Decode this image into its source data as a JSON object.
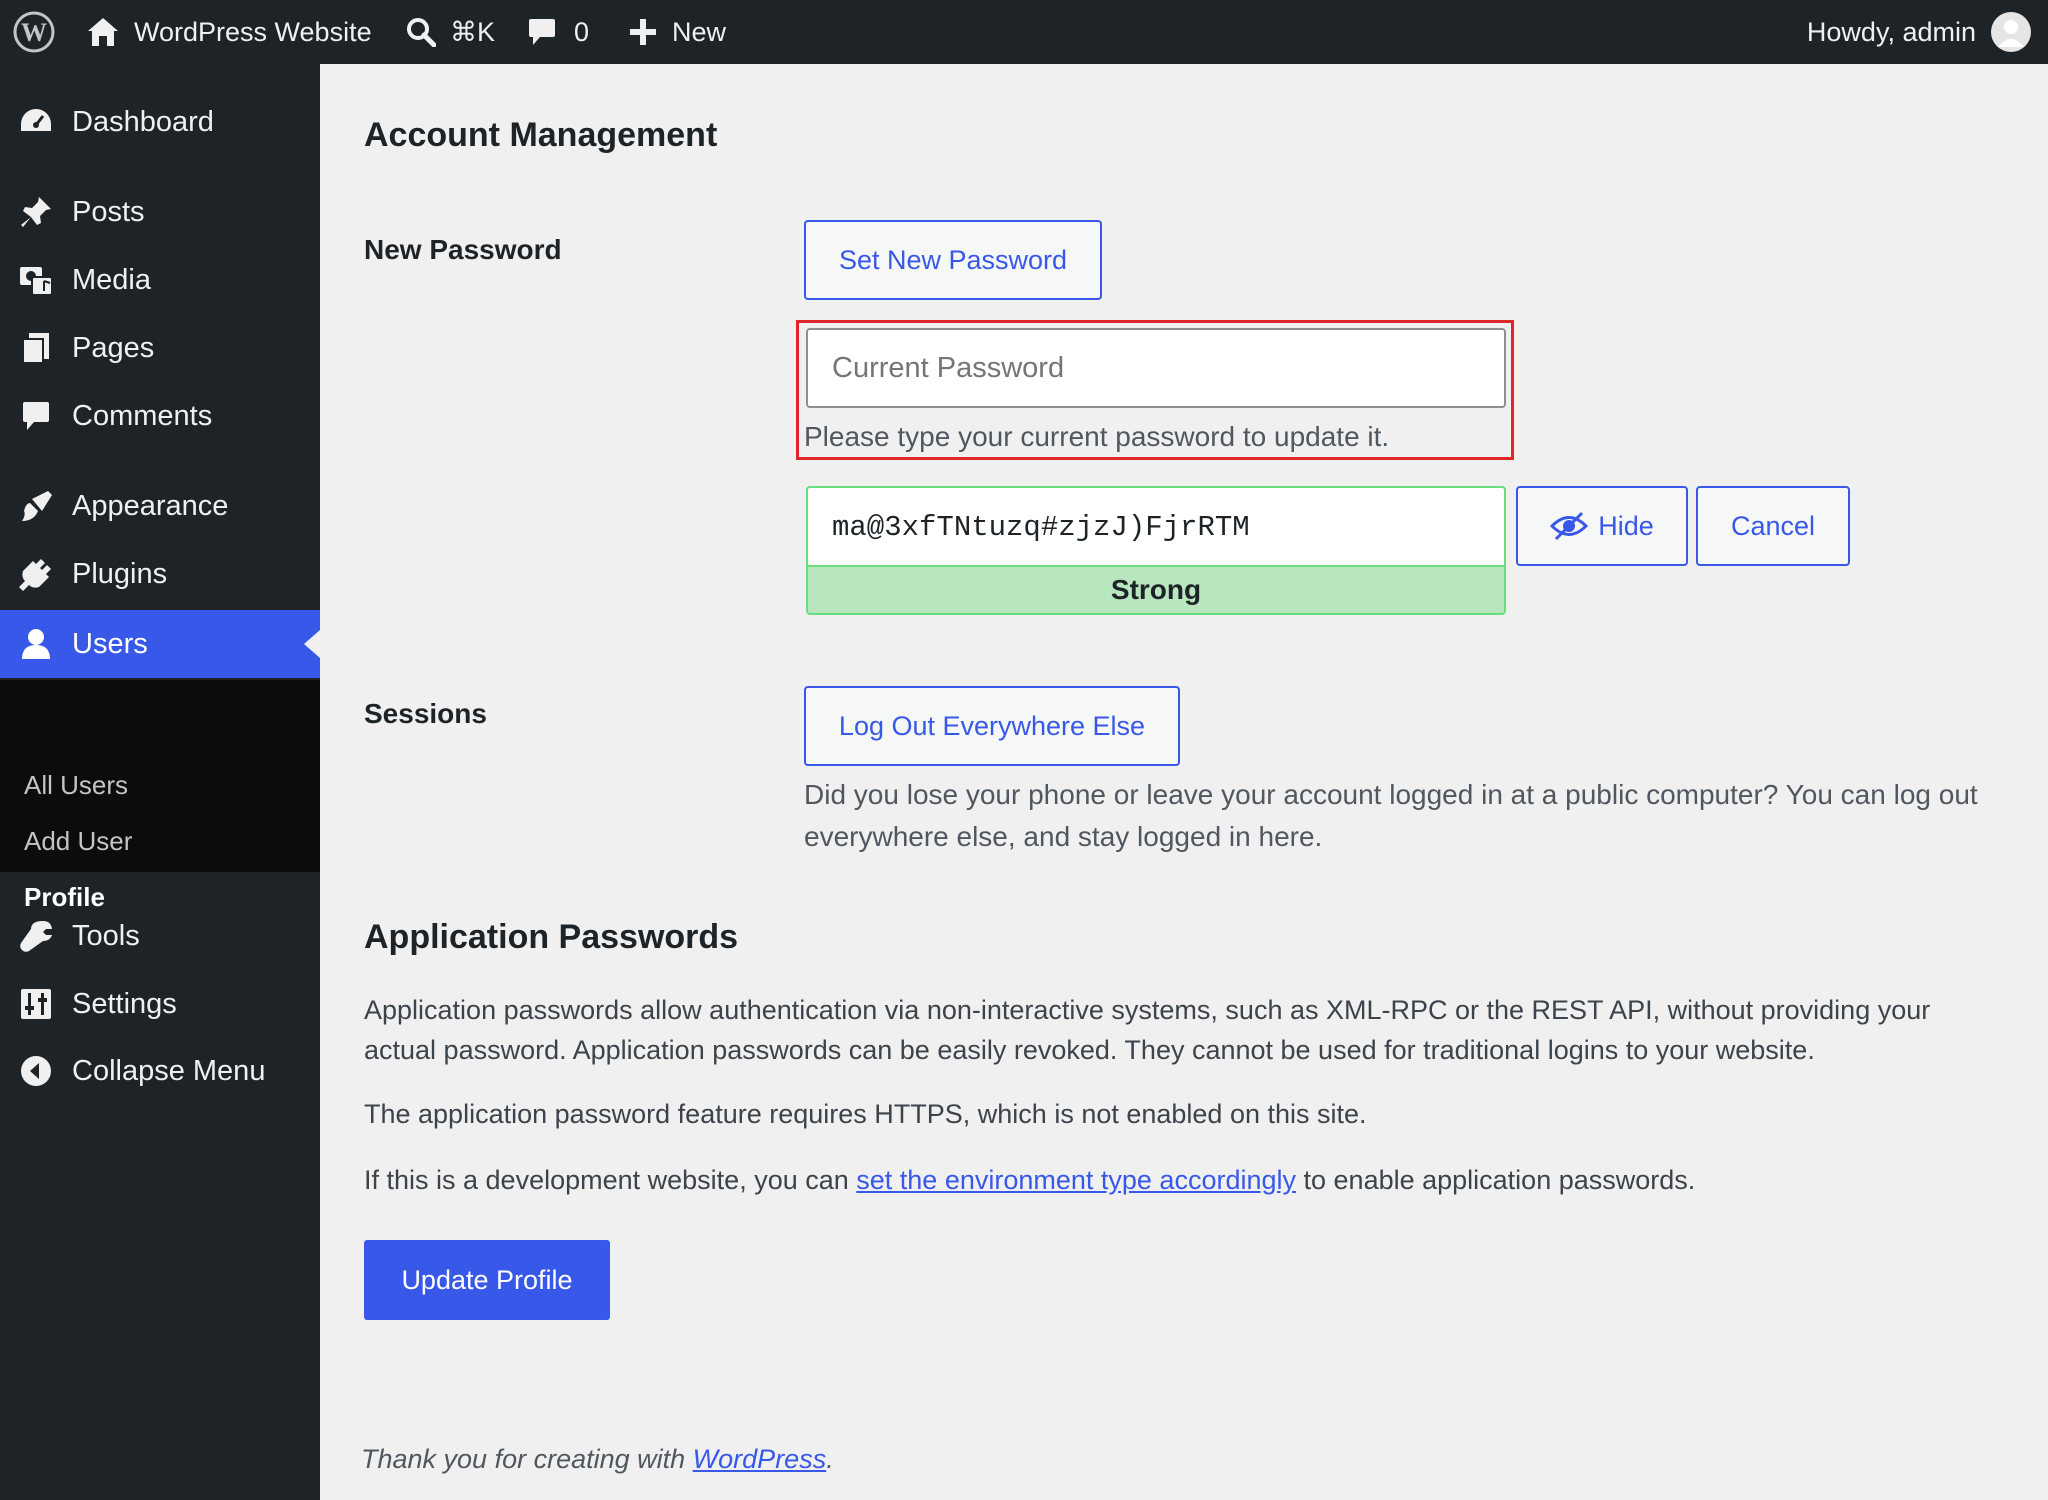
{
  "adminbar": {
    "site_name": "WordPress Website",
    "search_shortcut": "⌘K",
    "comments_count": "0",
    "new_label": "New",
    "greeting": "Howdy, admin"
  },
  "sidebar": {
    "items": [
      {
        "label": "Dashboard",
        "icon": "dashboard-icon"
      },
      {
        "label": "Posts",
        "icon": "pin-icon"
      },
      {
        "label": "Media",
        "icon": "media-icon"
      },
      {
        "label": "Pages",
        "icon": "pages-icon"
      },
      {
        "label": "Comments",
        "icon": "comment-icon"
      },
      {
        "label": "Appearance",
        "icon": "paintbrush-icon"
      },
      {
        "label": "Plugins",
        "icon": "plug-icon"
      },
      {
        "label": "Users",
        "icon": "user-icon"
      },
      {
        "label": "Tools",
        "icon": "wrench-icon"
      },
      {
        "label": "Settings",
        "icon": "sliders-icon"
      },
      {
        "label": "Collapse Menu",
        "icon": "collapse-icon"
      }
    ],
    "submenu": [
      "All Users",
      "Add User",
      "Profile"
    ]
  },
  "main": {
    "section_title": "Account Management",
    "new_password_label": "New Password",
    "set_new_password_button": "Set New Password",
    "current_password_placeholder": "Current Password",
    "current_password_hint": "Please type your current password to update it.",
    "generated_password": "ma@3xfTNtuzq#zjzJ)FjrRTM",
    "strength": "Strong",
    "hide_button": "Hide",
    "cancel_button": "Cancel",
    "sessions_label": "Sessions",
    "logout_button": "Log Out Everywhere Else",
    "sessions_desc": "Did you lose your phone or leave your account logged in at a public computer? You can log out everywhere else, and stay logged in here.",
    "app_passwords_title": "Application Passwords",
    "app_passwords_p1": "Application passwords allow authentication via non-interactive systems, such as XML-RPC or the REST API, without providing your actual password. Application passwords can be easily revoked. They cannot be used for traditional logins to your website.",
    "app_passwords_p2": "The application password feature requires HTTPS, which is not enabled on this site.",
    "app_passwords_p3_before": "If this is a development website, you can ",
    "app_passwords_p3_link": "set the environment type accordingly",
    "app_passwords_p3_after": " to enable application passwords.",
    "update_button": "Update Profile"
  },
  "footer": {
    "text_before": "Thank you for creating with ",
    "link": "WordPress",
    "text_after": "."
  },
  "colors": {
    "admin_bar": "#1d2327",
    "accent": "#3858e9",
    "highlight_border": "#e0262b",
    "strength_bg": "#b8e6bf"
  }
}
